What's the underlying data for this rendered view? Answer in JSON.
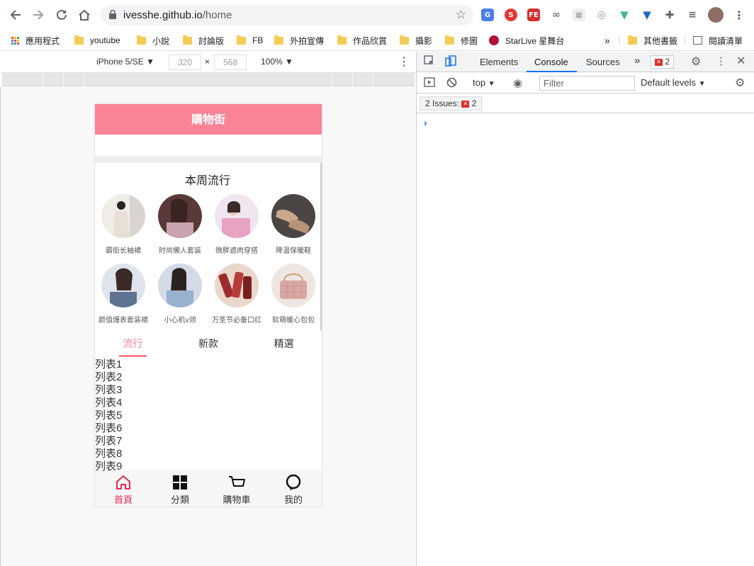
{
  "browser": {
    "url_host": "ivesshe.github.io",
    "url_path": "/home",
    "bookmarks": [
      {
        "label": "應用程式",
        "kind": "apps"
      },
      {
        "label": "youtube",
        "kind": "folder"
      },
      {
        "label": "小說",
        "kind": "folder"
      },
      {
        "label": "討論版",
        "kind": "folder"
      },
      {
        "label": "FB",
        "kind": "folder"
      },
      {
        "label": "外拍宣傳",
        "kind": "folder"
      },
      {
        "label": "作品欣賞",
        "kind": "folder"
      },
      {
        "label": "攝影",
        "kind": "folder"
      },
      {
        "label": "修圖",
        "kind": "folder"
      },
      {
        "label": "StarLive 星舞台",
        "kind": "site"
      }
    ],
    "bookmarks_more": "»",
    "other_bookmarks": "其他書籤",
    "reading_list": "閱讀清單"
  },
  "device_toolbar": {
    "device": "iPhone 5/SE",
    "width": "320",
    "times": "×",
    "height": "568",
    "zoom": "100%"
  },
  "app": {
    "title": "購物街",
    "recommend_title": "本周流行",
    "recommend_items": [
      {
        "label": "霸街长袖裙"
      },
      {
        "label": "时尚懒人套装"
      },
      {
        "label": "微胖遮肉穿搭"
      },
      {
        "label": "降温保暖鞋"
      },
      {
        "label": "颜值爆表套装裙"
      },
      {
        "label": "小心机v领"
      },
      {
        "label": "万圣节必备口红"
      },
      {
        "label": "软萌暖心包包"
      }
    ],
    "tabs": [
      "流行",
      "新款",
      "精選"
    ],
    "list": [
      "列表1",
      "列表2",
      "列表3",
      "列表4",
      "列表5",
      "列表6",
      "列表7",
      "列表8",
      "列表9"
    ],
    "tabbar": [
      {
        "label": "首頁",
        "icon": "home-icon"
      },
      {
        "label": "分類",
        "icon": "category-icon"
      },
      {
        "label": "購物車",
        "icon": "cart-icon"
      },
      {
        "label": "我的",
        "icon": "profile-icon"
      }
    ],
    "colors": {
      "header": "#fa8397",
      "active_tab": "#fa8397",
      "tabbar_active": "#e72850"
    }
  },
  "devtools": {
    "tabs": [
      "Elements",
      "Console",
      "Sources"
    ],
    "more_tabs": "»",
    "error_count": "2",
    "context": "top",
    "filter_placeholder": "Filter",
    "levels": "Default levels",
    "issues_label": "2 Issues:",
    "issues_count": "2",
    "prompt": "›"
  }
}
